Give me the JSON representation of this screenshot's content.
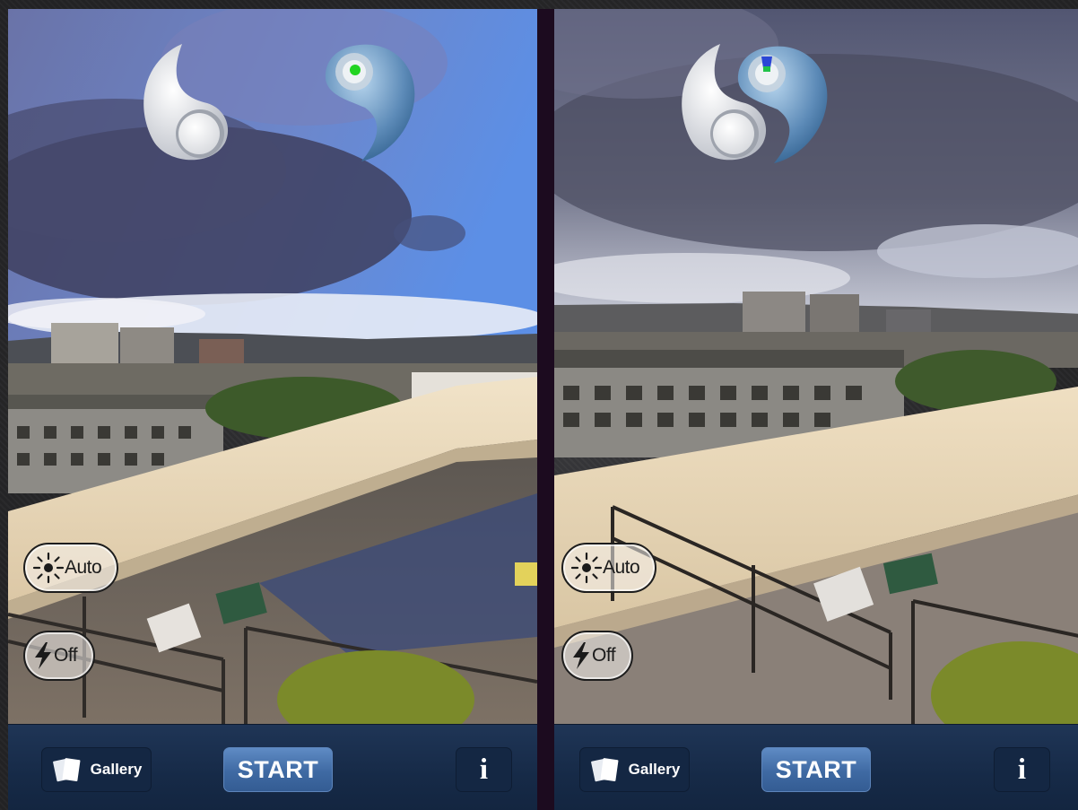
{
  "screens": [
    {
      "exposure": {
        "icon": "sun-icon",
        "label": "Auto"
      },
      "flash": {
        "icon": "lightning-icon",
        "label": "Off"
      },
      "toolbar": {
        "gallery_label": "Gallery",
        "start_label": "START",
        "info_label": "i"
      }
    },
    {
      "exposure": {
        "icon": "sun-icon",
        "label": "Auto"
      },
      "flash": {
        "icon": "lightning-icon",
        "label": "Off"
      },
      "toolbar": {
        "gallery_label": "Gallery",
        "start_label": "START",
        "info_label": "i"
      }
    }
  ],
  "colors": {
    "toolbar_bg": "#162a47",
    "start_button": "#4a75ad",
    "indicator_green": "#22d422",
    "indicator_blue": "#2b47d6"
  }
}
